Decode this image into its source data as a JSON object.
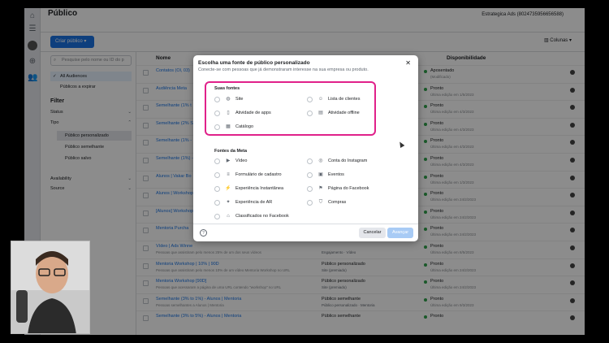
{
  "app": {
    "page_title": "Público",
    "account": "Estrategica Ads (8024735956656588)",
    "create_button": "Criar público",
    "columns_button": "Colunas"
  },
  "sidebar": {
    "search_placeholder": "Pesquise pelo nome ou ID do p",
    "items": [
      "All Audiences",
      "Públicos a expirar"
    ],
    "filter_title": "Filter",
    "filters": [
      "Status",
      "Tipo",
      "Availability",
      "Source"
    ],
    "tipo_options": [
      "Público personalizado",
      "Público semelhante",
      "Público salvo"
    ]
  },
  "table": {
    "headers": [
      "Nome",
      "Disponibilidade"
    ],
    "rows": [
      {
        "name": "Contatos (Ol, 03)",
        "sub": "",
        "type": "",
        "type_sub": "",
        "status": "Aposentado",
        "status_sub": "(Modificado)"
      },
      {
        "name": "Audiência Meta",
        "sub": "",
        "type": "",
        "type_sub": "",
        "status": "Pronto",
        "status_sub": "Última edição em 1/5/2023"
      },
      {
        "name": "Semelhante (1% t",
        "sub": "",
        "type": "",
        "type_sub": "Based LT...",
        "status": "Pronto",
        "status_sub": "Última edição em 4/3/2023"
      },
      {
        "name": "Semelhante (2% S",
        "sub": "",
        "type": "",
        "type_sub": "Based LT...",
        "status": "Pronto",
        "status_sub": "Última edição em 4/3/2023"
      },
      {
        "name": "Semelhante (1% -",
        "sub": "",
        "type": "",
        "type_sub": "Based LT...",
        "status": "Pronto",
        "status_sub": "Última edição em 4/3/2023"
      },
      {
        "name": "Semelhante (1%) -",
        "sub": "",
        "type": "",
        "type_sub": "Based LT...",
        "status": "Pronto",
        "status_sub": "Última edição em 4/3/2023"
      },
      {
        "name": "Alunos | Vakar Bo",
        "sub": "",
        "type": "",
        "type_sub": "",
        "status": "Pronto",
        "status_sub": "Última edição em 1/3/2023"
      },
      {
        "name": "Alunos | Workshop",
        "sub": "",
        "type": "",
        "type_sub": "",
        "status": "Pronto",
        "status_sub": "Última edição em 24/2/2023"
      },
      {
        "name": "[Alunos] Workshop",
        "sub": "",
        "type": "",
        "type_sub": "",
        "status": "Pronto",
        "status_sub": "Última edição em 24/2/2023"
      },
      {
        "name": "Mentoria Purcha",
        "sub": "",
        "type": "",
        "type_sub": "",
        "status": "Pronto",
        "status_sub": "Última edição em 24/2/2023"
      },
      {
        "name": "Vídeo | Ads Winne",
        "sub": "Pessoas que assistiram pelo menos 25% de um dos seus vídeos",
        "type": "",
        "type_sub": "Engajamento · Vídeo",
        "status": "Pronto",
        "status_sub": "Última edição em 8/5/2023"
      },
      {
        "name": "Mentoria Workshop | 10% | 90D",
        "sub": "Pessoas que assistiram pelo menos 10% de um vídeo Mentoria Workshop no URL",
        "type": "Público personalizado",
        "type_sub": "Site (premiado)",
        "status": "Pronto",
        "status_sub": "Última edição em 24/2/2023"
      },
      {
        "name": "Mentoria Workshop [90D]",
        "sub": "Pessoas que acessaram a página de uma URL contendo \"workshop\" no URL",
        "type": "Público personalizado",
        "type_sub": "Site (premiado)",
        "status": "Pronto",
        "status_sub": "Última edição em 24/2/2023"
      },
      {
        "name": "Semelhante (3% to 1%) - Alunos | Mentoria",
        "sub": "Pessoas semelhantes a Alunos | Mentoria",
        "type": "Público semelhante",
        "type_sub": "Público personalizado · Mentoria",
        "status": "Pronto",
        "status_sub": "Última edição em 9/3/2023"
      },
      {
        "name": "Semelhante (3% to 5%) - Alunos | Mentoria",
        "sub": "",
        "type": "Público semelhante",
        "type_sub": "",
        "status": "Pronto",
        "status_sub": ""
      }
    ]
  },
  "modal": {
    "title": "Escolha uma fonte de público personalizado",
    "subtitle": "Conecte-se com pessoas que já demonstraram interesse na sua empresa ou produto.",
    "your_sources_title": "Suas fontes",
    "your_sources": [
      "Site",
      "Lista de clientes",
      "Atividade de apps",
      "Atividade offline",
      "Catálogo"
    ],
    "meta_sources_title": "Fontes da Meta",
    "meta_sources": [
      "Vídeo",
      "Conta do Instagram",
      "Formulário de cadastro",
      "Eventos",
      "Experiência Instantânea",
      "Página do Facebook",
      "Experiência de AR",
      "Compras",
      "Classificados no Facebook"
    ],
    "cancel": "Cancelar",
    "next": "Avançar",
    "help": "?"
  }
}
